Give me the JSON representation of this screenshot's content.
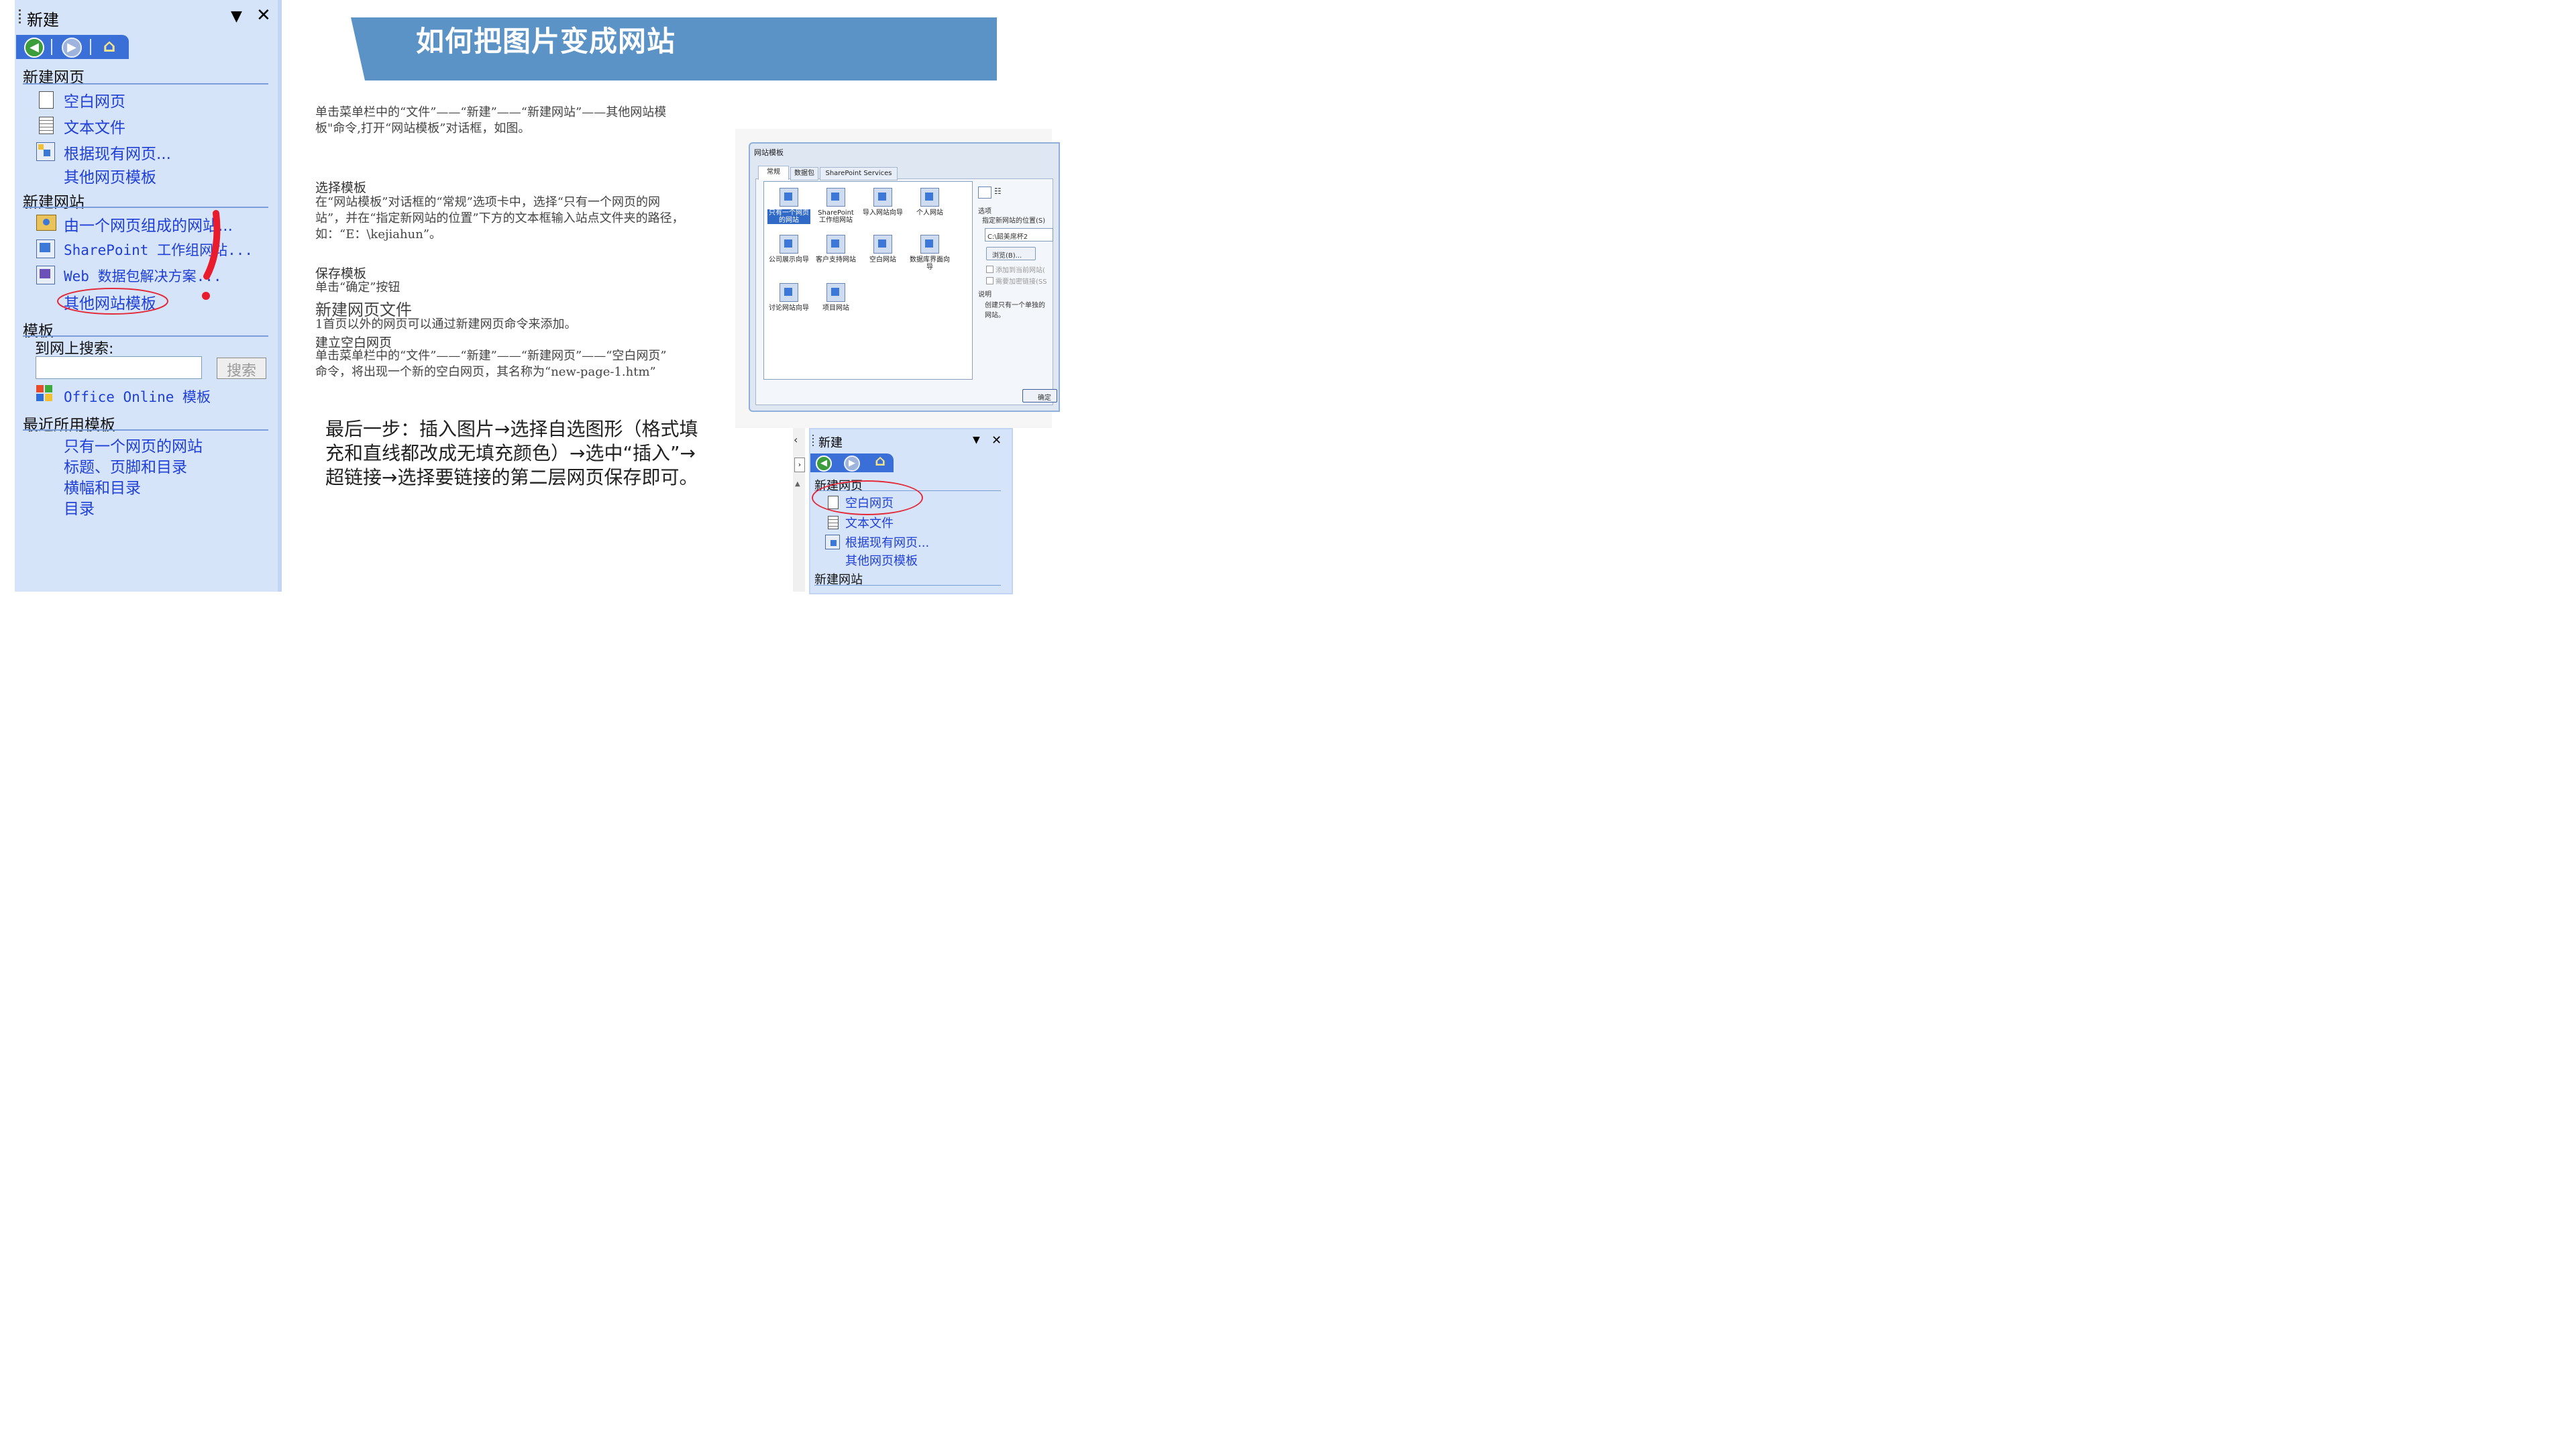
{
  "left_pane": {
    "title": "新建",
    "new_page": {
      "heading": "新建网页",
      "items": [
        "空白网页",
        "文本文件",
        "根据现有网页...",
        "其他网页模板"
      ]
    },
    "new_site": {
      "heading": "新建网站",
      "items": [
        "由一个网页组成的网站...",
        "SharePoint 工作组网站...",
        "Web 数据包解决方案...",
        "其他网站模板"
      ]
    },
    "templates": {
      "heading": "模板",
      "search_label": "到网上搜索:",
      "search_value": "",
      "search_button": "搜索",
      "office_online": "Office Online 模板"
    },
    "recent": {
      "heading": "最近所用模板",
      "items": [
        "只有一个网页的网站",
        "标题、页脚和目录",
        "横幅和目录",
        "目录"
      ]
    }
  },
  "banner": {
    "title": "如何把图片变成网站",
    "color": "#5b93c6"
  },
  "body": {
    "intro": [
      "单击菜单栏中的“文件”——“新建”——“新建网站”——其他网站模",
      "板\"命令,打开“网站模板”对话框，如图。"
    ],
    "select_heading": "选择模板",
    "select_text": [
      "在“网站模板”对话框的“常规”选项卡中，选择“只有一个网页的网",
      "站”，并在“指定新网站的位置”下方的文本框输入站点文件夹的路径，",
      "如：“E：\\kejiahun”。"
    ],
    "save_heading": "保存模板",
    "save_text": "单击“确定”按钮",
    "new_page_heading": "新建网页文件",
    "new_page_text": "1首页以外的网页可以通过新建网页命令来添加。",
    "blank_heading": "建立空白网页",
    "blank_text": [
      "单击菜单栏中的“文件”——“新建”——“新建网页”——“空白网页”",
      "命令，将出现一个新的空白网页，其名称为“new-page-1.htm”"
    ],
    "final": [
      "最后一步：插入图片→选择自选图形（格式填",
      "充和直线都改成无填充颜色）→选中“插入”→",
      "超链接→选择要链接的第二层网页保存即可。"
    ]
  },
  "dialog": {
    "title": "网站模板",
    "tabs": [
      "常规",
      "数据包",
      "SharePoint Services"
    ],
    "templates": [
      "只有一个网页的网站",
      "SharePoint 工作组网站",
      "导入网站向导",
      "个人网站",
      "公司展示向导",
      "客户支持网站",
      "空白网站",
      "数据库界面向导",
      "讨论网站向导",
      "项目网站"
    ],
    "options_label": "选项",
    "location_label": "指定新网站的位置(S)",
    "location_value": "C:\\韶美席杯2",
    "browse_button": "浏览(B)...",
    "check1": "添加到当前网站(",
    "check2": "需要加密链接(SS",
    "desc_label": "说明",
    "desc_text": [
      "创建只有一个单独的",
      "网站。"
    ],
    "ok_button": "确定"
  },
  "pane2": {
    "title": "新建",
    "heading": "新建网页",
    "items": [
      "空白网页",
      "文本文件",
      "根据现有网页...",
      "其他网页模板"
    ],
    "heading2": "新建网站"
  }
}
